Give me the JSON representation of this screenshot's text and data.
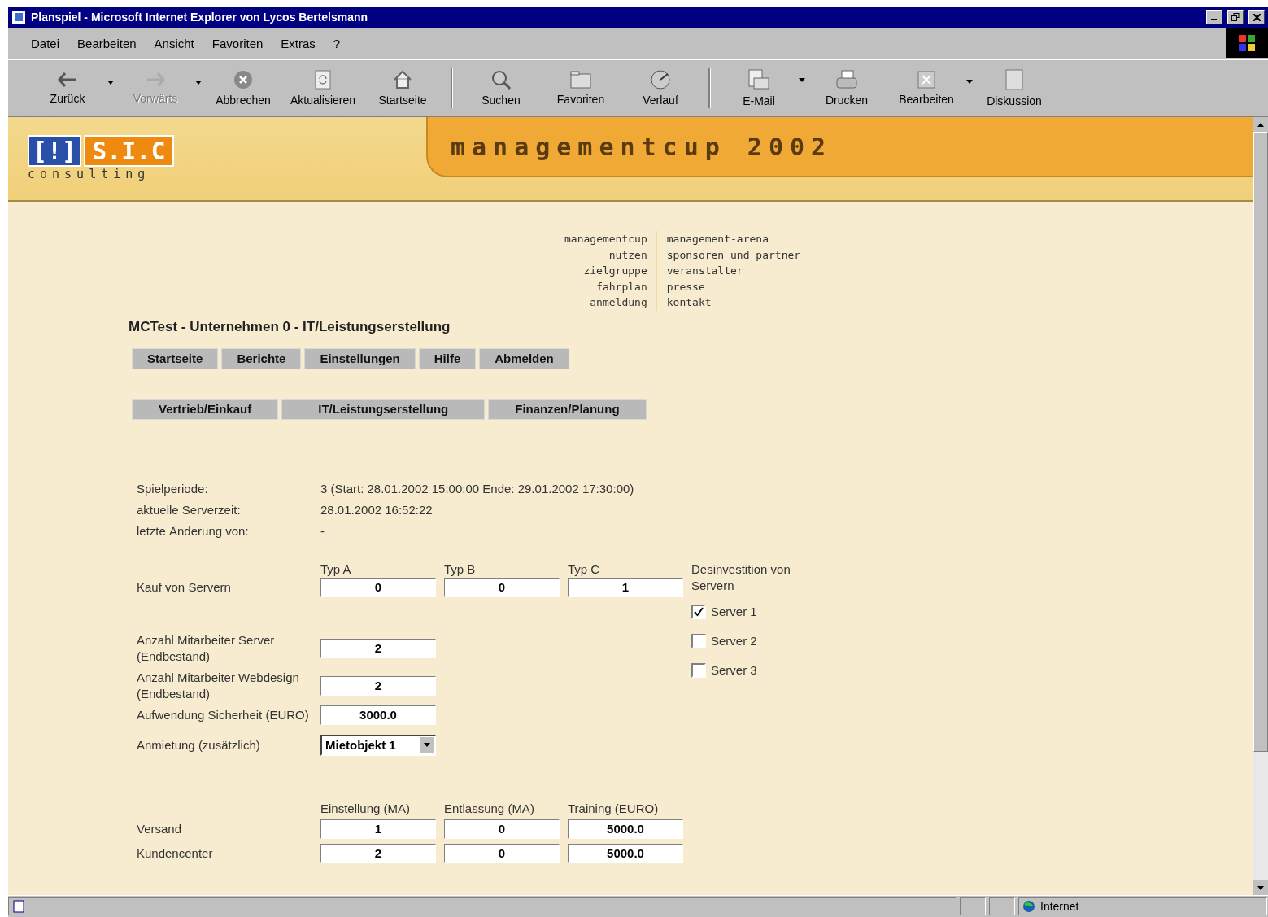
{
  "window": {
    "title": "Planspiel - Microsoft Internet Explorer von Lycos Bertelsmann"
  },
  "menu": [
    "Datei",
    "Bearbeiten",
    "Ansicht",
    "Favoriten",
    "Extras",
    "?"
  ],
  "toolbar": [
    [
      {
        "label": "Zurück",
        "disabled": false,
        "dropdown": true
      },
      {
        "label": "Vorwärts",
        "disabled": true,
        "dropdown": true
      },
      {
        "label": "Abbrechen",
        "disabled": false,
        "dropdown": false
      },
      {
        "label": "Aktualisieren",
        "disabled": false,
        "dropdown": false
      },
      {
        "label": "Startseite",
        "disabled": false,
        "dropdown": false
      }
    ],
    [
      {
        "label": "Suchen",
        "disabled": false,
        "dropdown": false
      },
      {
        "label": "Favoriten",
        "disabled": false,
        "dropdown": false
      },
      {
        "label": "Verlauf",
        "disabled": false,
        "dropdown": false
      }
    ],
    [
      {
        "label": "E-Mail",
        "disabled": false,
        "dropdown": true
      },
      {
        "label": "Drucken",
        "disabled": false,
        "dropdown": false
      },
      {
        "label": "Bearbeiten",
        "disabled": false,
        "dropdown": true
      },
      {
        "label": "Diskussion",
        "disabled": false,
        "dropdown": false
      }
    ]
  ],
  "header": {
    "logo_mark": "[!]",
    "logo_name": "S.I.C",
    "logo_sub": "consulting",
    "banner": "managementcup 2002"
  },
  "nav": {
    "left": [
      "managementcup",
      "nutzen",
      "zielgruppe",
      "fahrplan",
      "anmeldung"
    ],
    "right": [
      "management-arena",
      "sponsoren und partner",
      "veranstalter",
      "presse",
      "kontakt"
    ]
  },
  "page_title": "MCTest - Unternehmen 0 - IT/Leistungserstellung",
  "top_buttons": [
    "Startseite",
    "Berichte",
    "Einstellungen",
    "Hilfe",
    "Abmelden"
  ],
  "section_tabs": [
    "Vertrieb/Einkauf",
    "IT/Leistungserstellung",
    "Finanzen/Planung"
  ],
  "info": [
    {
      "label": "Spielperiode:",
      "value": "3 (Start: 28.01.2002 15:00:00 Ende: 29.01.2002 17:30:00)"
    },
    {
      "label": "aktuelle Serverzeit:",
      "value": "28.01.2002 16:52:22"
    },
    {
      "label": "letzte Änderung von:",
      "value": "-"
    }
  ],
  "servers": {
    "columns": [
      "Typ A",
      "Typ B",
      "Typ C"
    ],
    "label": "Kauf von Servern",
    "values": [
      "0",
      "0",
      "1"
    ]
  },
  "divest": {
    "heading": "Desinvestition von Servern",
    "items": [
      {
        "label": "Server 1",
        "checked": true
      },
      {
        "label": "Server 2",
        "checked": false
      },
      {
        "label": "Server 3",
        "checked": false
      }
    ]
  },
  "fields": [
    {
      "label": "Anzahl Mitarbeiter Server (Endbestand)",
      "value": "2"
    },
    {
      "label": "Anzahl Mitarbeiter Webdesign (Endbestand)",
      "value": "2"
    },
    {
      "label": "Aufwendung Sicherheit (EURO)",
      "value": "3000.0"
    }
  ],
  "rental": {
    "label": "Anmietung (zusätzlich)",
    "value": "Mietobjekt 1"
  },
  "staff": {
    "columns": [
      "Einstellung (MA)",
      "Entlassung (MA)",
      "Training (EURO)"
    ],
    "rows": [
      {
        "label": "Versand",
        "values": [
          "1",
          "0",
          "5000.0"
        ]
      },
      {
        "label": "Kundencenter",
        "values": [
          "2",
          "0",
          "5000.0"
        ]
      }
    ]
  },
  "status_bar": {
    "zone": "Internet"
  }
}
